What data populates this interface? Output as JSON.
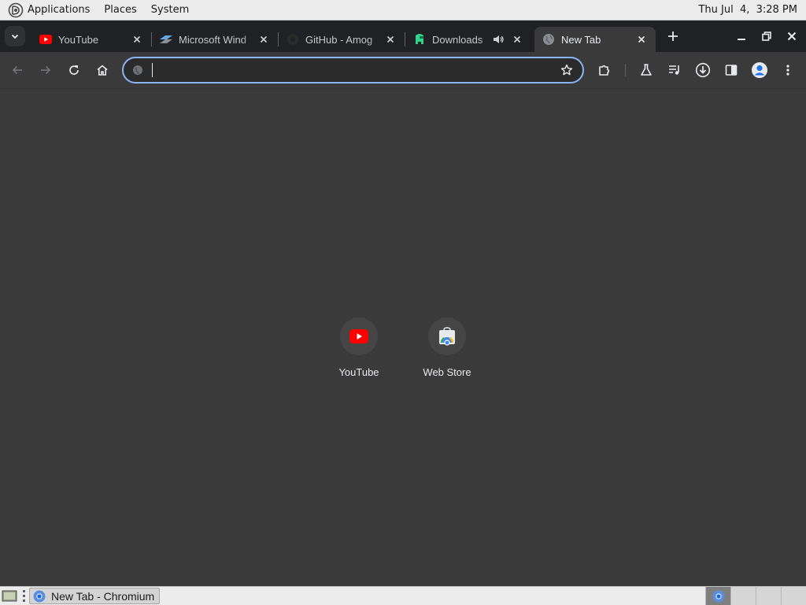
{
  "top_panel": {
    "menus": [
      "Applications",
      "Places",
      "System"
    ],
    "clock": "Thu Jul  4,  3:28 PM"
  },
  "tabs": [
    {
      "title": "YouTube",
      "favicon": "youtube-icon",
      "active": false
    },
    {
      "title": "Microsoft Wind",
      "favicon": "windows-icon",
      "active": false
    },
    {
      "title": "GitHub - Amog",
      "favicon": "github-icon",
      "active": false
    },
    {
      "title": "Downloads",
      "favicon": "downloads-site-icon",
      "active": false,
      "audio": "speaker-icon"
    },
    {
      "title": "New Tab",
      "favicon": "globe-icon",
      "active": true
    }
  ],
  "toolbar": {
    "omnibox_value": "",
    "omnibox_placeholder": ""
  },
  "shortcuts": [
    {
      "label": "YouTube",
      "icon": "youtube-icon"
    },
    {
      "label": "Web Store",
      "icon": "web-store-icon"
    }
  ],
  "bottom_panel": {
    "taskbar_entry": "New Tab - Chromium",
    "workspaces": 4,
    "active_workspace": 1
  },
  "colors": {
    "page_bg": "#3a3a3a",
    "tab_strip_bg": "#202124",
    "omnibox_focus": "#8ab4f8",
    "youtube_red": "#ff0000"
  }
}
